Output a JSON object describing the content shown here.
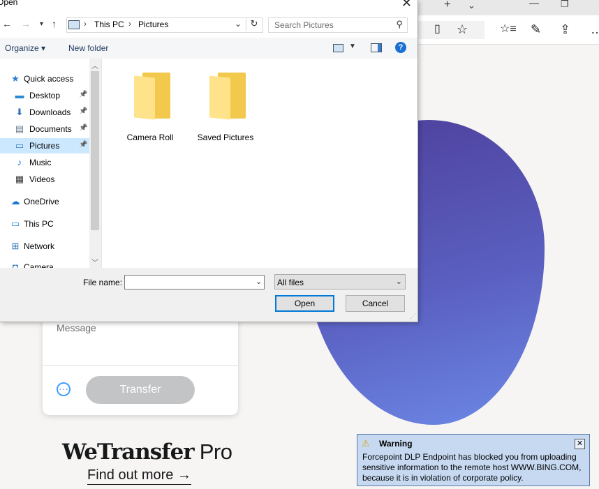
{
  "browser": {
    "tab_icons": [
      "+",
      "⌄",
      "—",
      "❐"
    ],
    "toolbar_icons": [
      "reading-view-icon",
      "favorite-star-icon",
      "favorites-list-icon",
      "pen-icon",
      "share-icon",
      "more-icon"
    ]
  },
  "dialog": {
    "title": "Open",
    "close_glyph": "✕",
    "path": {
      "root": "This PC",
      "folder": "Pictures"
    },
    "search_placeholder": "Search Pictures",
    "cmd": {
      "organize": "Organize ▾",
      "new_folder": "New folder"
    },
    "nav": [
      {
        "label": "Quick access",
        "icon": "star-icon",
        "glyph": "★",
        "color": "#2b7cd3"
      },
      {
        "label": "Desktop",
        "icon": "desktop-icon",
        "glyph": "▬",
        "color": "#2a8ad4",
        "pinned": true
      },
      {
        "label": "Downloads",
        "icon": "download-arrow-icon",
        "glyph": "⬇",
        "color": "#2a6fb8",
        "pinned": true
      },
      {
        "label": "Documents",
        "icon": "document-icon",
        "glyph": "▤",
        "color": "#6a7a8a",
        "pinned": true
      },
      {
        "label": "Pictures",
        "icon": "pictures-icon",
        "glyph": "▭",
        "color": "#3d7fc8",
        "pinned": true,
        "selected": true
      },
      {
        "label": "Music",
        "icon": "music-note-icon",
        "glyph": "♪",
        "color": "#1a73d6"
      },
      {
        "label": "Videos",
        "icon": "film-icon",
        "glyph": "▦",
        "color": "#333"
      },
      {
        "label": "OneDrive",
        "icon": "cloud-icon",
        "glyph": "☁",
        "color": "#1677d2"
      },
      {
        "label": "This PC",
        "icon": "computer-icon",
        "glyph": "▭",
        "color": "#2a8ad4"
      },
      {
        "label": "Network",
        "icon": "network-icon",
        "glyph": "⊞",
        "color": "#2a6fb8"
      },
      {
        "label": "Camera",
        "icon": "camera-icon",
        "glyph": "◘",
        "color": "#2a6fb8"
      }
    ],
    "folders": [
      "Camera Roll",
      "Saved Pictures"
    ],
    "file_name_label": "File name:",
    "file_name_value": "",
    "file_type": "All files",
    "open_label": "Open",
    "cancel_label": "Cancel",
    "help_label": "?"
  },
  "page": {
    "message_placeholder": "Message",
    "transfer_label": "Transfer",
    "more_label": "···",
    "brand_bold": "WeTransfer",
    "brand_light": " Pro",
    "find_out": "Find out more →"
  },
  "warning": {
    "title": "Warning",
    "message": "Forcepoint DLP Endpoint has blocked you from uploading sensitive information to the remote host WWW.BING.COM, because it is in violation of corporate policy.",
    "close_glyph": "✕"
  }
}
